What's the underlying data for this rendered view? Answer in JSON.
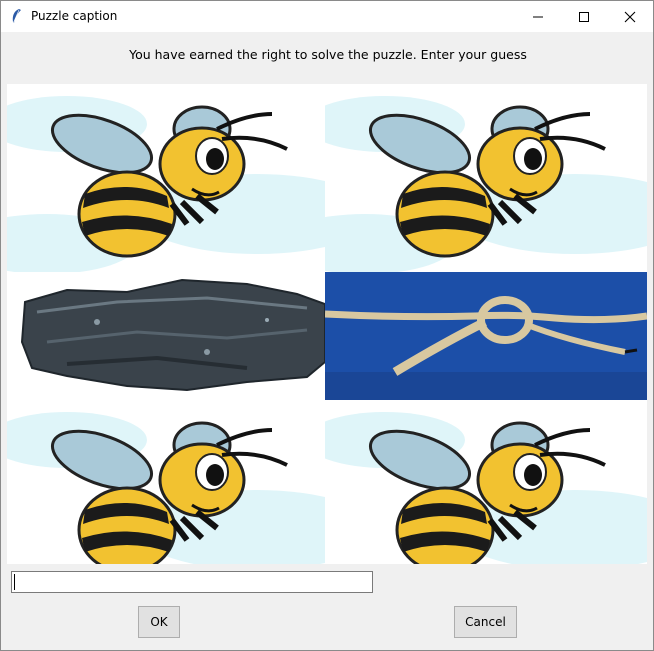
{
  "window": {
    "title": "Puzzle caption",
    "app_icon": "feather-icon",
    "controls": {
      "minimize": "minimize-icon",
      "maximize": "maximize-icon",
      "close": "close-icon"
    }
  },
  "prompt": "You have earned the right to solve the puzzle.   Enter your guess",
  "puzzle": {
    "tiles": [
      {
        "name": "bee",
        "row": 1,
        "col": 1
      },
      {
        "name": "bee",
        "row": 1,
        "col": 2
      },
      {
        "name": "rock",
        "row": 2,
        "col": 1
      },
      {
        "name": "knot",
        "row": 2,
        "col": 2
      },
      {
        "name": "bee",
        "row": 3,
        "col": 1
      },
      {
        "name": "bee",
        "row": 3,
        "col": 2
      }
    ]
  },
  "guess": {
    "value": "",
    "placeholder": ""
  },
  "buttons": {
    "ok": "OK",
    "cancel": "Cancel"
  },
  "colors": {
    "bee_yellow": "#f2c230",
    "bee_stripe": "#1b1b1b",
    "wing": "#a9c9d8",
    "sky": "#d9f3f8",
    "knot_bg": "#1c4fa8",
    "rope": "#d8c8a0",
    "rock": "#3a434b"
  }
}
